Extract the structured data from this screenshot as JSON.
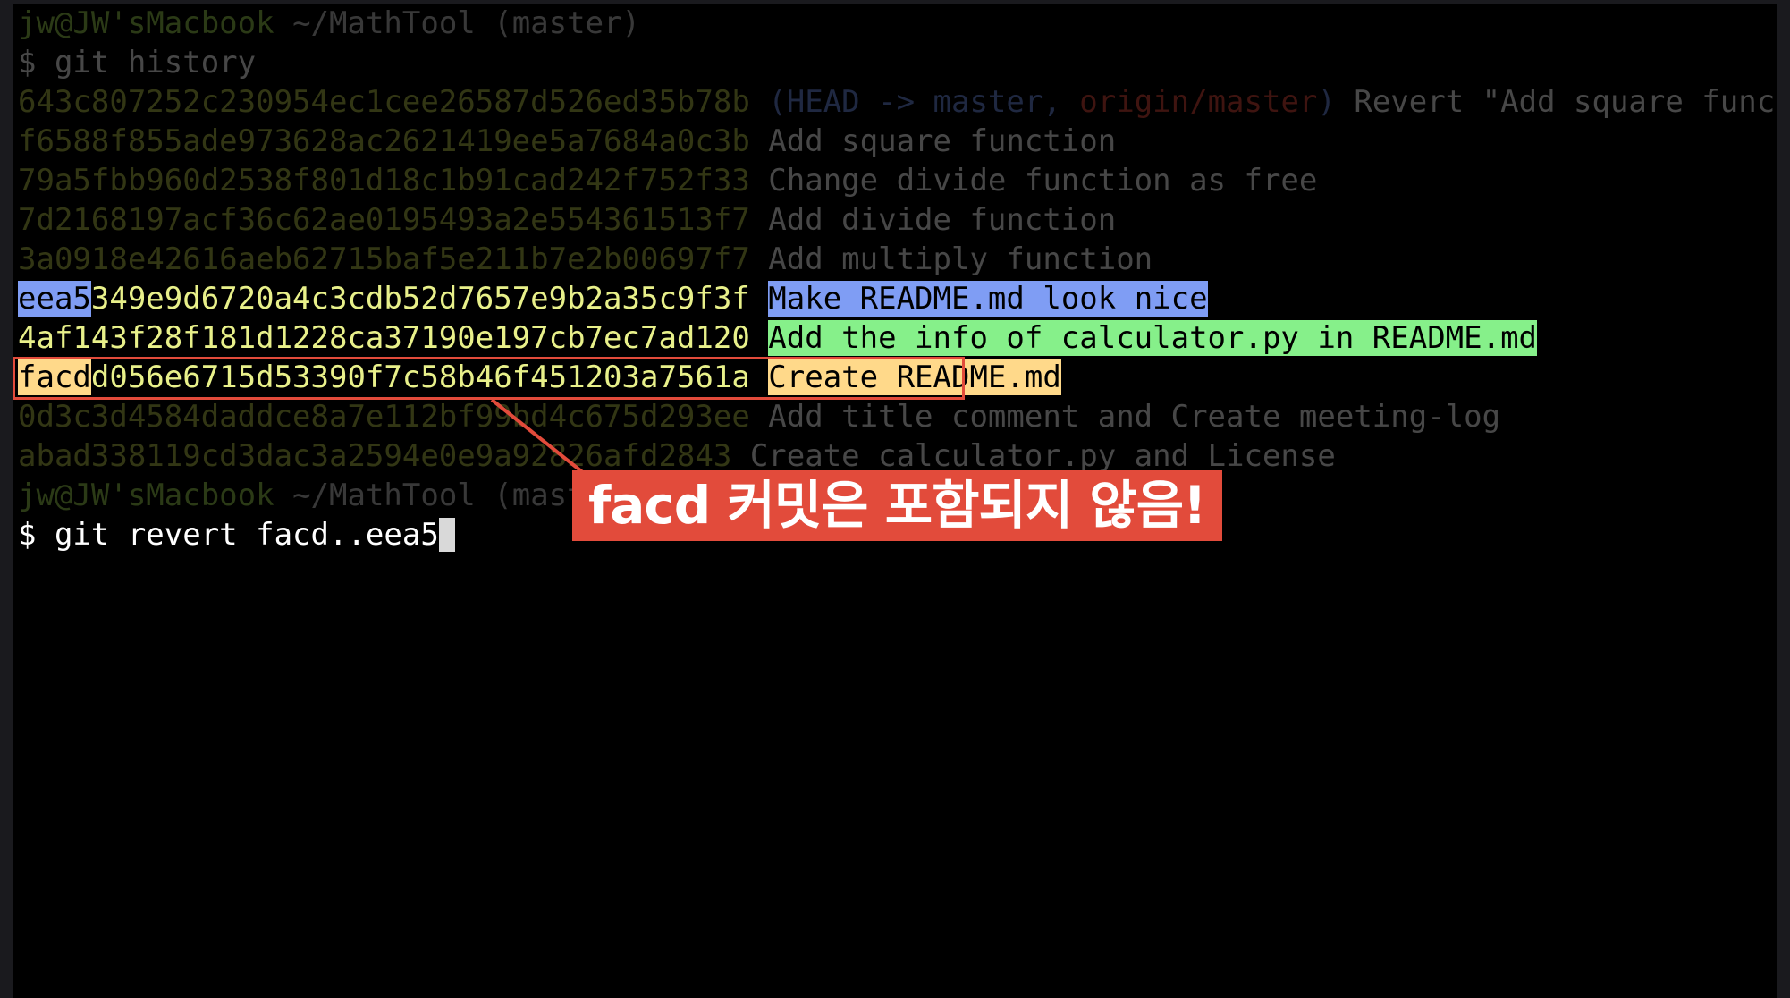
{
  "terminal": {
    "prompt1": {
      "user": "jw@JW'sMacbook",
      "path": "~/MathTool",
      "branch": "(master)"
    },
    "cmd1": "$ git history",
    "log": [
      {
        "hash": "643c807252c230954ec1cee26587d526ed35b78b",
        "refs_open": "(",
        "head": "HEAD -> master",
        "sep": ", ",
        "origin": "origin/master",
        "refs_close": ")",
        "msg": "Revert \"Add square function\""
      },
      {
        "hash": "f6588f855ade973628ac2621419ee5a7684a0c3b",
        "msg": "Add square function"
      },
      {
        "hash": "79a5fbb960d2538f801d18c1b91cad242f752f33",
        "msg": "Change divide function as free"
      },
      {
        "hash": "7d2168197acf36c62ae0195493a2e554361513f7",
        "msg": "Add divide function"
      },
      {
        "hash": "3a0918e42616aeb62715baf5e211b7e2b00697f7",
        "msg": "Add multiply function"
      },
      {
        "hash_prefix": "eea5",
        "hash_rest": "349e9d6720a4c3cdb52d7657e9b2a35c9f3f",
        "msg": "Make README.md look nice"
      },
      {
        "hash": "4af143f28f181d1228ca37190e197cb7ec7ad120",
        "msg": "Add the info of calculator.py in README.md"
      },
      {
        "hash_prefix": "facd",
        "hash_rest": "d056e6715d53390f7c58b46f451203a7561a",
        "msg": "Create README.md"
      },
      {
        "hash": "0d3c3d4584daddce8a7e112bf99bd4c675d293ee",
        "msg": "Add title comment and Create meeting-log"
      },
      {
        "hash": "abad338119cd3dac3a2594e0e9a92826afd2843",
        "msg": "Create calculator.py and License"
      }
    ],
    "prompt2": {
      "user": "jw@JW'sMacbook",
      "path": "~/MathTool",
      "branch": "(master)"
    },
    "cmd2": "$ git revert facd..eea5"
  },
  "callout": {
    "text": "facd 커밋은 포함되지 않음!"
  },
  "colors": {
    "highlight_blue": "#7f9df4",
    "highlight_green": "#86f08a",
    "highlight_orange": "#ffd98a",
    "callout_red": "#e24b3b"
  }
}
